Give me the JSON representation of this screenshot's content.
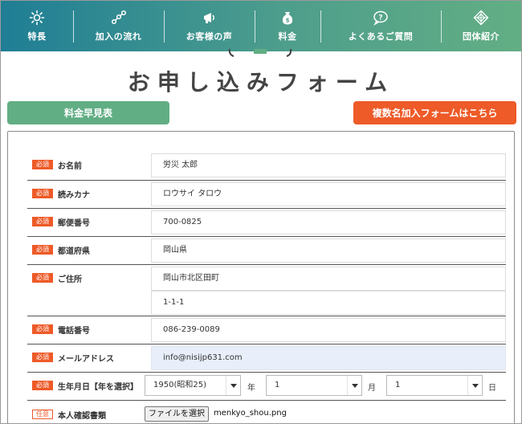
{
  "nav": {
    "items": [
      {
        "label": "特長",
        "icon": "sun-icon"
      },
      {
        "label": "加入の流れ",
        "icon": "flow-icon"
      },
      {
        "label": "お客様の声",
        "icon": "megaphone-icon"
      },
      {
        "label": "料金",
        "icon": "money-bag-icon"
      },
      {
        "label": "よくあるご質問",
        "icon": "question-bubble-icon"
      },
      {
        "label": "団体紹介",
        "icon": "diamond-icon"
      }
    ]
  },
  "page": {
    "title": "お申し込みフォーム"
  },
  "buttons": {
    "fee_table": "料金早見表",
    "multi_form": "複数名加入フォームはこちら"
  },
  "badges": {
    "required": "必須",
    "optional": "任意"
  },
  "form": {
    "name": {
      "label": "お名前",
      "value": "労災 太郎"
    },
    "kana": {
      "label": "読みカナ",
      "value": "ロウサイ タロウ"
    },
    "postal": {
      "label": "郵便番号",
      "value": "700-0825"
    },
    "prefecture": {
      "label": "都道府県",
      "value": "岡山県"
    },
    "address": {
      "label": "ご住所",
      "value1": "岡山市北区田町",
      "value2": "1-1-1"
    },
    "phone": {
      "label": "電話番号",
      "value": "086-239-0089"
    },
    "email": {
      "label": "メールアドレス",
      "value": "info@nisijp631.com"
    },
    "birth": {
      "label": "生年月日【年を選択】",
      "year": "1950(昭和25)",
      "year_unit": "年",
      "month": "1",
      "month_unit": "月",
      "day": "1",
      "day_unit": "日"
    },
    "id_doc": {
      "label": "本人確認書類",
      "button": "ファイルを選択",
      "filename": "menkyo_shou.png"
    }
  },
  "colors": {
    "nav_start": "#1f7e95",
    "nav_end": "#62ae84",
    "accent_green": "#62ae84",
    "accent_orange": "#ee5a28",
    "focus_bg": "#e8effa"
  }
}
